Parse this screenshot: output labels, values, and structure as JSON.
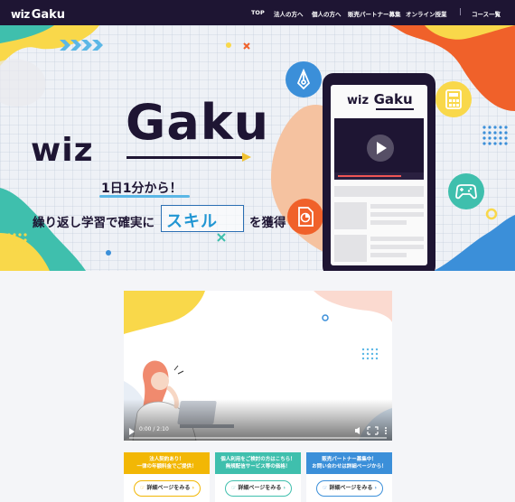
{
  "header": {
    "logo": {
      "w": "wiz",
      "g": "Gaku"
    },
    "nav": [
      "TOP",
      "法人の方へ",
      "個人の方へ",
      "販売パートナー募集",
      "オンライン授業",
      "コース一覧"
    ]
  },
  "hero": {
    "logo": {
      "w": "wiz",
      "g": "Gaku"
    },
    "tagline_1": "1日1分から！",
    "tagline_2_pre": "繰り返し学習で確実に",
    "tagline_2_highlight": "スキル",
    "tagline_2_post": "を獲得",
    "phone": {
      "logo": {
        "w": "wiz",
        "g": "Gaku"
      }
    }
  },
  "video": {
    "time": "0:00 / 2:10"
  },
  "cta_cards": [
    {
      "head": "法人契約あり！\n一律の年額料金でご提供！",
      "button": "詳細ページをみる",
      "color": "#f2b705"
    },
    {
      "head": "個人利用をご検討の方はこちら！\n無規配信サービス等の価格！",
      "button": "詳細ページをみる",
      "color": "#3fbfad"
    },
    {
      "head": "販売パートナー募集中！\nお問い合わせは詳細ページから！",
      "button": "詳細ページをみる",
      "color": "#3b8fd9"
    }
  ],
  "colors": {
    "header_bg": "#1e1533",
    "brand_dark": "#1e1533",
    "accent_blue": "#2196d3",
    "yellow": "#f9d84a",
    "orange": "#f0612a",
    "teal": "#3fbfad"
  }
}
